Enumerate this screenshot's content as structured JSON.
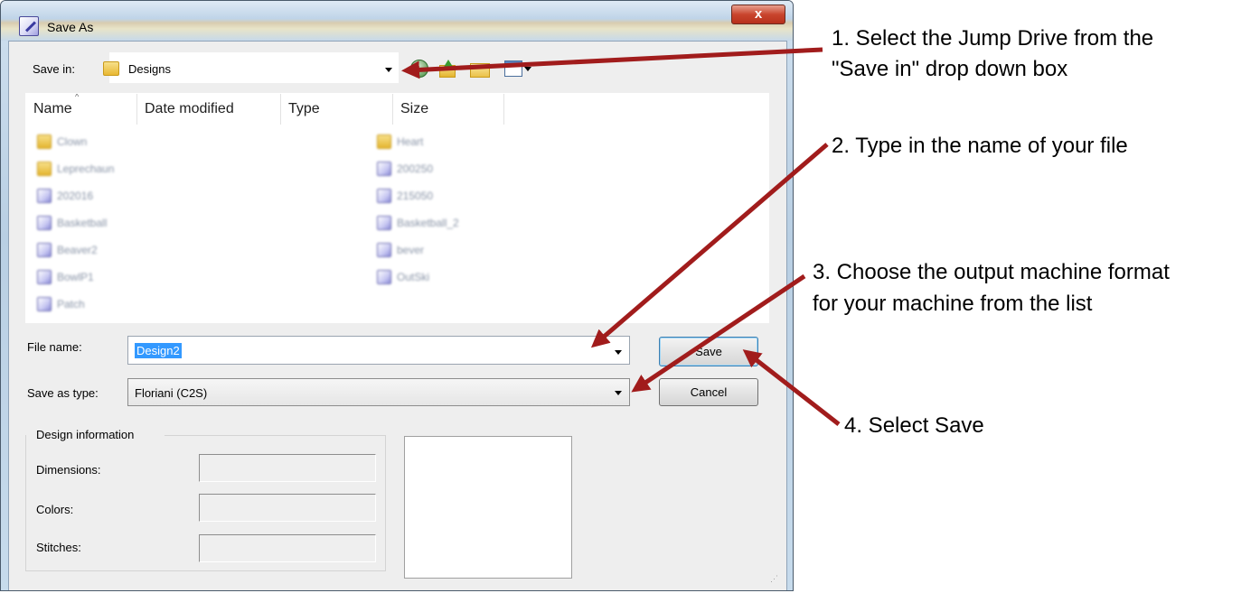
{
  "dialog": {
    "title": "Save As",
    "close_label": "x"
  },
  "save_in": {
    "label": "Save in:",
    "value": "Designs"
  },
  "toolbar": {
    "icons": [
      "back-icon",
      "up-folder-icon",
      "new-folder-icon",
      "views-icon"
    ]
  },
  "file_list": {
    "columns": [
      "Name",
      "Date modified",
      "Type",
      "Size"
    ],
    "left_items": [
      {
        "name": "Clown",
        "icon": "folder-icon"
      },
      {
        "name": "Leprechaun",
        "icon": "folder-icon"
      },
      {
        "name": "202016",
        "icon": "design-file-icon"
      },
      {
        "name": "Basketball",
        "icon": "design-file-icon"
      },
      {
        "name": "Beaver2",
        "icon": "design-file-icon"
      },
      {
        "name": "BowlP1",
        "icon": "design-file-icon"
      },
      {
        "name": "Patch",
        "icon": "design-file-icon"
      }
    ],
    "right_items": [
      {
        "name": "Heart",
        "icon": "folder-icon"
      },
      {
        "name": "200250",
        "icon": "design-file-icon"
      },
      {
        "name": "215050",
        "icon": "design-file-icon"
      },
      {
        "name": "Basketball_2",
        "icon": "design-file-icon"
      },
      {
        "name": "bever",
        "icon": "design-file-icon"
      },
      {
        "name": "OutSki",
        "icon": "design-file-icon"
      }
    ]
  },
  "file_name": {
    "label": "File name:",
    "value": "Design2"
  },
  "save_as_type": {
    "label": "Save as type:",
    "value": "Floriani (C2S)"
  },
  "buttons": {
    "save": "Save",
    "cancel": "Cancel"
  },
  "design_info": {
    "group_label": "Design information",
    "dimensions_label": "Dimensions:",
    "colors_label": "Colors:",
    "stitches_label": "Stitches:"
  },
  "annotations": {
    "step1_line1": "1. Select the Jump Drive from the",
    "step1_line2": "\"Save in\" drop down box",
    "step2": "2. Type in the name of your file",
    "step3_line1": "3. Choose the output machine format",
    "step3_line2": "for your machine from the list",
    "step4": "4. Select Save"
  },
  "colors": {
    "arrow": "#a11c1c",
    "selection": "#3399ff",
    "close_button": "#c9452e"
  }
}
